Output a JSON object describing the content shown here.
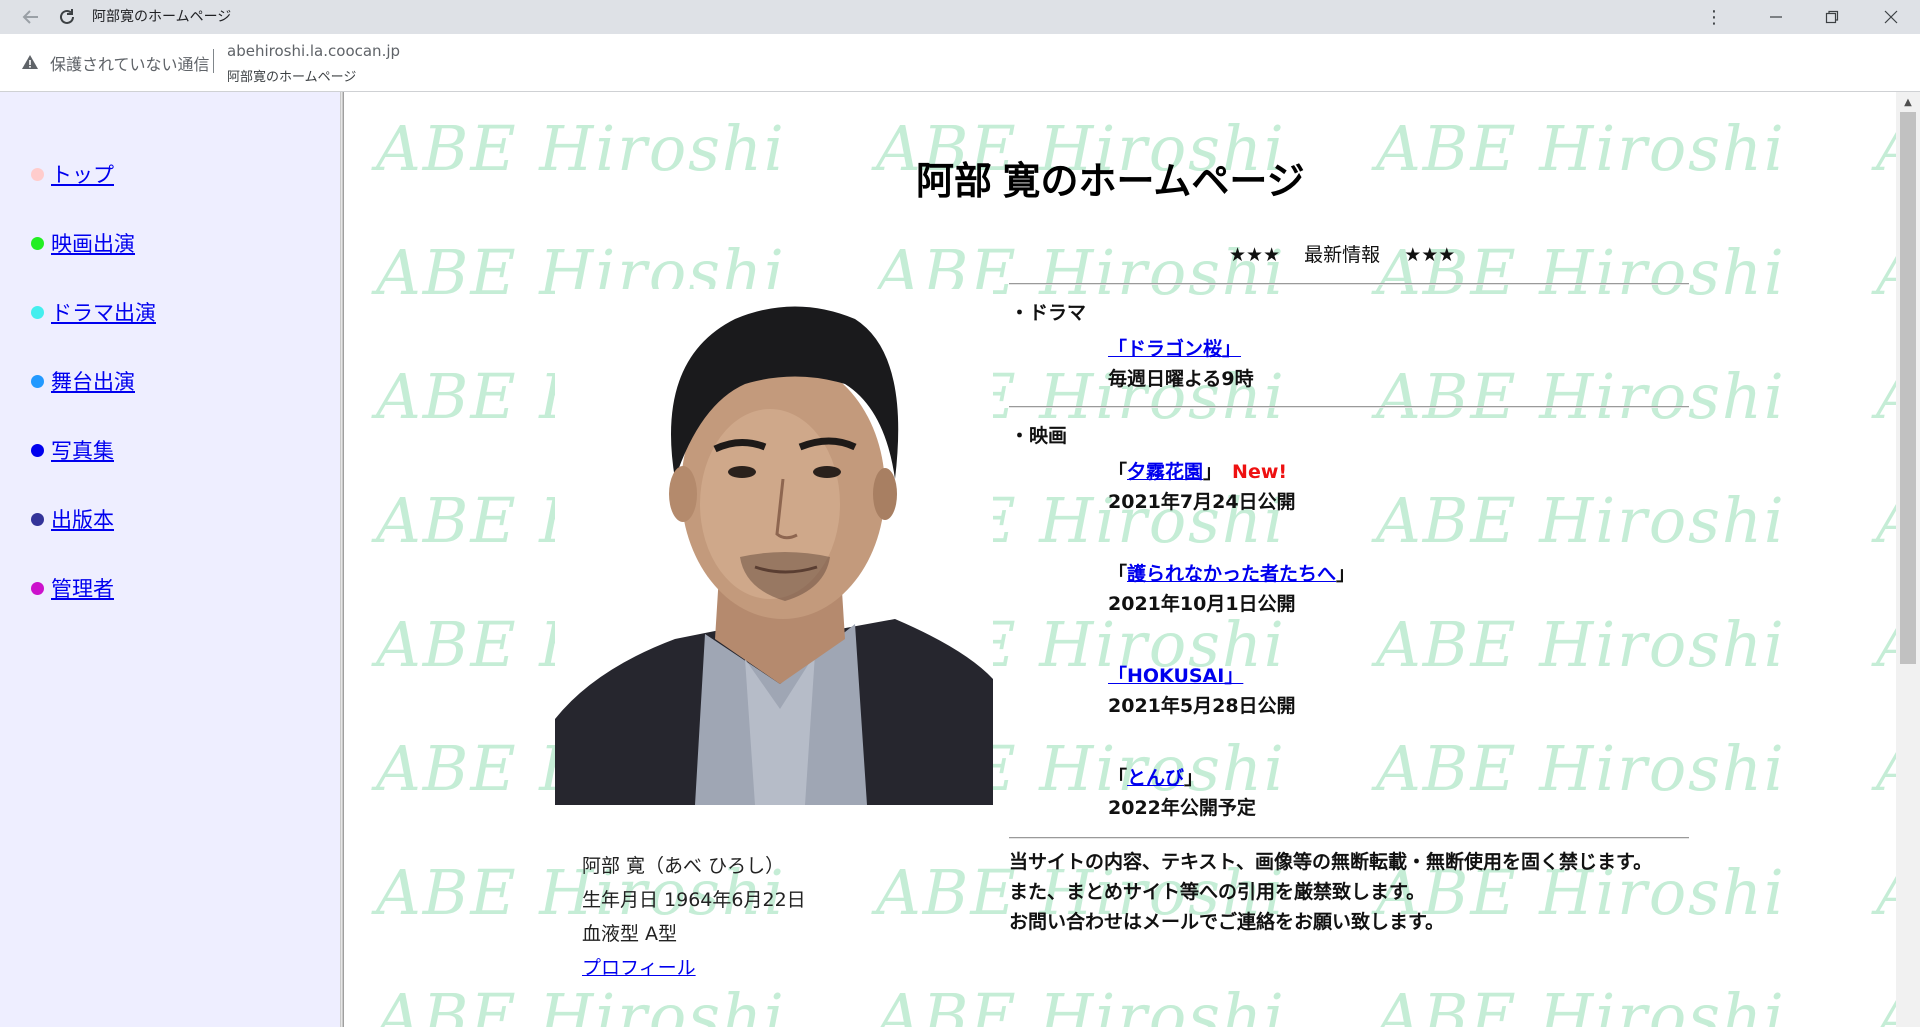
{
  "browser": {
    "tab_title": "阿部寛のホームページ",
    "security_text": "保護されていない通信",
    "url": "abehiroshi.la.coocan.jp",
    "url_subtitle": "阿部寛のホームページ",
    "icons": [
      "back-arrow-icon",
      "reload-icon",
      "kebab-menu-icon",
      "minimize-icon",
      "restore-icon",
      "close-icon",
      "warning-triangle-icon"
    ]
  },
  "nav": {
    "items": [
      {
        "label": "トップ",
        "dot_color": "#ffcccc"
      },
      {
        "label": "映画出演",
        "dot_color": "#22ee22"
      },
      {
        "label": "ドラマ出演",
        "dot_color": "#44eeee"
      },
      {
        "label": "舞台出演",
        "dot_color": "#2299ff"
      },
      {
        "label": "写真集",
        "dot_color": "#0000ee"
      },
      {
        "label": "出版本",
        "dot_color": "#333399"
      },
      {
        "label": "管理者",
        "dot_color": "#cc11cc"
      }
    ]
  },
  "main": {
    "title": "阿部 寛のホームページ",
    "news": {
      "stars": "★★★",
      "heading": "最新情報"
    },
    "watermark_text": "ABE Hiroshi",
    "drama": {
      "section_label": "・ドラマ",
      "title": "「ドラゴン桜」",
      "schedule": "毎週日曜よる9時"
    },
    "movie": {
      "section_label": "・映画",
      "items": [
        {
          "open": "「",
          "title": "夕霧花園",
          "close": "」",
          "badge": "New!",
          "date": "2021年7月24日公開"
        },
        {
          "open": "「",
          "title": "護られなかった者たちへ",
          "close": "」",
          "date": "2021年10月1日公開"
        },
        {
          "open": "",
          "title": "「HOKUSAI」",
          "close": "",
          "date": "2021年5月28日公開"
        },
        {
          "open": "「",
          "title": "とんび",
          "close": "」",
          "date": "2022年公開予定"
        }
      ]
    },
    "notice": [
      "当サイトの内容、テキスト、画像等の無断転載・無断使用を固く禁じます。",
      "また、まとめサイト等への引用を厳禁致します。",
      "お問い合わせはメールでご連絡をお願い致します。"
    ],
    "profile": {
      "name": "阿部 寛（あべ ひろし）",
      "birthday": "生年月日 1964年6月22日",
      "blood": "血液型 A型",
      "link": "プロフィール"
    }
  },
  "colors": {
    "nav_bg": "#eeeeff",
    "link": "#0000ee",
    "new_badge": "#ee1111",
    "watermark": "#c5edd6"
  }
}
